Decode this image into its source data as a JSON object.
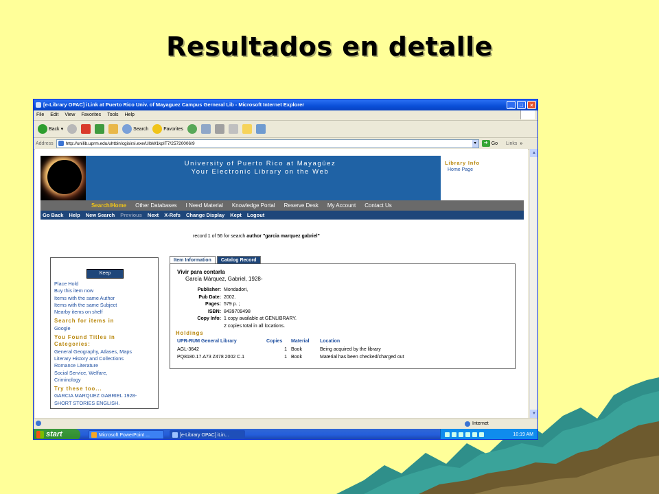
{
  "slide": {
    "title": "Resultados en detalle"
  },
  "browser": {
    "window_title": "[e-Library OPAC] iLink at Puerto Rico Univ. of Mayaguez Campus Gerneral Lib - Microsoft Internet Explorer",
    "menu": [
      "File",
      "Edit",
      "View",
      "Favorites",
      "Tools",
      "Help"
    ],
    "toolbar": {
      "back": "Back",
      "search": "Search",
      "favorites": "Favorites"
    },
    "address_label": "Address",
    "url": "http://unilib.uprm.edu/uhtbin/cgisirsi.exe/UlbW1kpIT7/25720006/9",
    "go": "Go",
    "links": "Links",
    "status_zone": "Internet"
  },
  "site": {
    "title_line1": "University of Puerto Rico at Mayagüez",
    "title_line2": "Your Electronic Library on the Web",
    "library_info": "Library Info",
    "home_page": "Home Page",
    "nav_primary": [
      "Search/Home",
      "Other Databases",
      "I Need Material",
      "Knowledge Portal",
      "Reserve Desk",
      "My Account",
      "Contact Us"
    ],
    "nav_secondary": [
      "Go Back",
      "Help",
      "New Search",
      "Previous",
      "Next",
      "X-Refs",
      "Change Display",
      "Kept",
      "Logout"
    ],
    "record_prefix": "record 1 of 56 for search",
    "record_query": "author \"garcia marquez gabriel\""
  },
  "sidebar": {
    "keep_button": "Keep",
    "links": [
      "Place Hold",
      "Buy this item now",
      "Items with the same Author",
      "Items with the same Subject",
      "Nearby items on shelf"
    ],
    "search_heading": "Search for items in",
    "search_link": "Google",
    "found_heading_1": "You Found Titles in",
    "found_heading_2": "Categories:",
    "categories": [
      "General Geography, Atlases, Maps",
      "Literary History and Collections",
      "Romance Literature",
      "Social Service, Welfare,",
      "Criminology"
    ],
    "try_heading": "Try these too...",
    "try_links": [
      "GARCIA MARQUEZ GABRIEL 1928-",
      "SHORT STORIES ENGLISH."
    ]
  },
  "record": {
    "tab_active": "Item Information",
    "tab_other": "Catalog Record",
    "title": "Vivir para contarla",
    "author": "García Márquez, Gabriel, 1928-",
    "fields": [
      {
        "label": "Publisher:",
        "value": "Mondadori,"
      },
      {
        "label": "Pub Date:",
        "value": "2002."
      },
      {
        "label": "Pages:",
        "value": "579 p. ;"
      },
      {
        "label": "ISBN:",
        "value": "8439709498"
      },
      {
        "label": "Copy Info:",
        "value": "1 copy available at GENLIBRARY."
      }
    ],
    "copy_info_line2": "2 copies total in all locations.",
    "holdings_heading": "Holdings",
    "holdings_columns": [
      "UPR-RUM General Library",
      "Copies",
      "Material",
      "Location"
    ],
    "holdings_rows": [
      [
        "AGL-3642",
        "1",
        "Book",
        "Being acquired by the library"
      ],
      [
        "PQ8180.17.A73 Z478 2002 C.1",
        "1",
        "Book",
        "Material has been checked/charged out"
      ]
    ]
  },
  "taskbar": {
    "start": "start",
    "tasks": [
      "Microsoft PowerPoint ...",
      "[e-Library OPAC] iLin..."
    ],
    "clock": "10:19 AM"
  }
}
